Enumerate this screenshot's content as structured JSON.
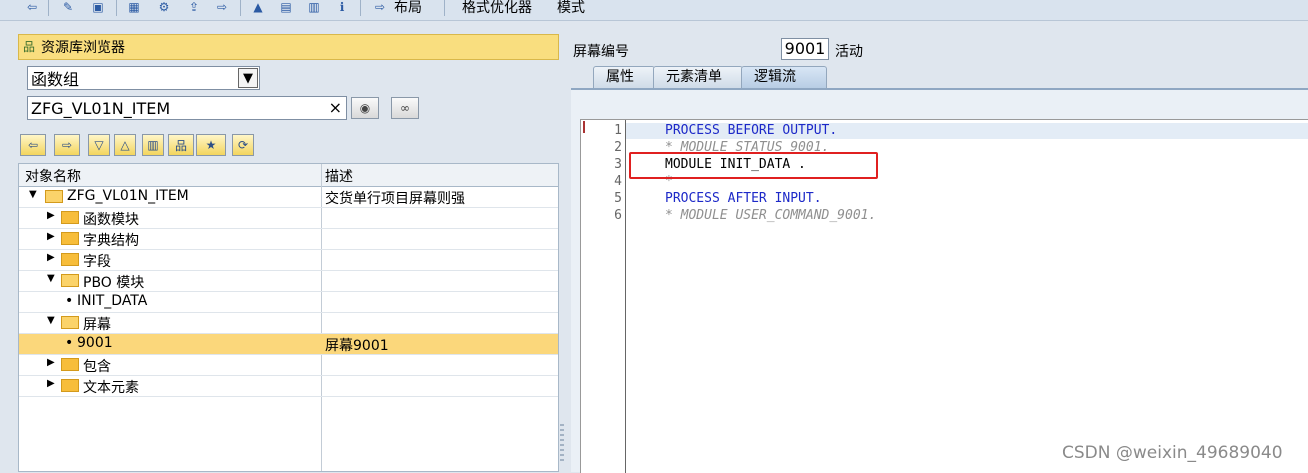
{
  "toolbar": {
    "layout_label": "布局",
    "pretty_printer_label": "格式优化器",
    "mode_label": "模式"
  },
  "repo_browser": {
    "title": "资源库浏览器",
    "object_type": "函数组",
    "object_name": "ZFG_VL01N_ITEM",
    "columns": {
      "name": "对象名称",
      "desc": "描述"
    },
    "rows": [
      {
        "name": "ZFG_VL01N_ITEM",
        "desc": "交货单行项目屏幕则强",
        "kind": "folder-open"
      },
      {
        "name": "函数模块",
        "desc": "",
        "kind": "folder"
      },
      {
        "name": "字典结构",
        "desc": "",
        "kind": "folder"
      },
      {
        "name": "字段",
        "desc": "",
        "kind": "folder"
      },
      {
        "name": "PBO 模块",
        "desc": "",
        "kind": "folder-open"
      },
      {
        "name": "INIT_DATA",
        "desc": "",
        "kind": "leaf"
      },
      {
        "name": "屏幕",
        "desc": "",
        "kind": "folder-open"
      },
      {
        "name": "9001",
        "desc": "屏幕9001",
        "kind": "leaf",
        "selected": true
      },
      {
        "name": "包含",
        "desc": "",
        "kind": "folder"
      },
      {
        "name": "文本元素",
        "desc": "",
        "kind": "folder"
      }
    ]
  },
  "screen": {
    "number_label": "屏幕编号",
    "number": "9001",
    "status": "活动"
  },
  "tabs": [
    "属性",
    "元素清单",
    "逻辑流"
  ],
  "active_tab": "逻辑流",
  "code": {
    "line_numbers": [
      "1",
      "2",
      "3",
      "4",
      "5",
      "6"
    ],
    "lines": [
      "PROCESS BEFORE OUTPUT.",
      "* MODULE STATUS_9001.",
      "MODULE INIT_DATA .",
      "*",
      "PROCESS AFTER INPUT.",
      "* MODULE USER_COMMAND_9001."
    ]
  },
  "watermark": "CSDN @weixin_49689040",
  "colors": {
    "keyword": "#1d29c8",
    "comment": "#8f8f8f",
    "selected_row": "#fbd77b",
    "header_bar": "#f9de7f",
    "highlight_box": "#e02020"
  }
}
